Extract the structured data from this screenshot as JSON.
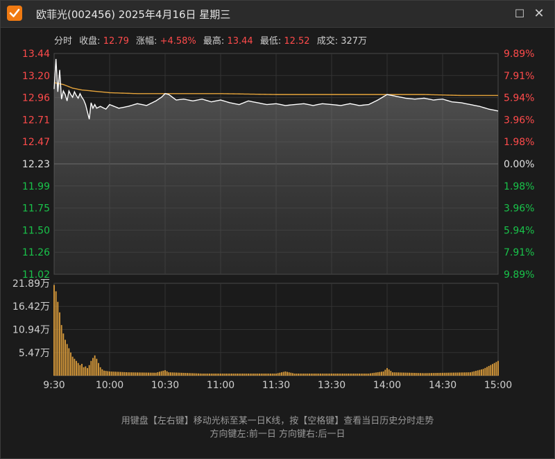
{
  "window": {
    "title": "欧菲光(002456) 2025年4月16日 星期三",
    "maximize_label": "☐",
    "close_label": "✕"
  },
  "info": {
    "mode": "分时",
    "close_label": "收盘:",
    "close_value": "12.79",
    "change_label": "涨幅:",
    "change_value": "+4.58%",
    "high_label": "最高:",
    "high_value": "13.44",
    "low_label": "最低:",
    "low_value": "12.52",
    "volume_label": "成交:",
    "volume_value": "327万"
  },
  "footer": {
    "line1": "用键盘【左右键】移动光标至某一日K线，按【空格键】查看当日历史分时走势",
    "line2": "方向键左:前一日    方向键右:后一日"
  },
  "colors": {
    "up": "#ff4b4b",
    "down": "#19c34a",
    "neutral": "#e0e0e0",
    "price_line": "#ffffff",
    "avg_line": "#e6a43b",
    "volume_bar": "#d79a3a"
  },
  "chart_data": [
    {
      "type": "line",
      "name": "intraday-price",
      "ylim": [
        11.02,
        13.44
      ],
      "prev_close": 12.23,
      "y_ticks_left": [
        "13.44",
        "13.20",
        "12.96",
        "12.71",
        "12.47",
        "12.23",
        "11.99",
        "11.75",
        "11.50",
        "11.26",
        "11.02"
      ],
      "y_ticks_right": [
        "9.89%",
        "7.91%",
        "5.94%",
        "3.96%",
        "1.98%",
        "0.00%",
        "1.98%",
        "3.96%",
        "5.94%",
        "7.91%",
        "9.89%"
      ],
      "x_ticks": [
        "9:30",
        "10:00",
        "10:30",
        "11:00",
        "11:30",
        "13:30",
        "14:00",
        "14:30",
        "15:00"
      ],
      "minutes": 241,
      "price_keypoints": [
        [
          0,
          13.05
        ],
        [
          1,
          13.38
        ],
        [
          2,
          13.02
        ],
        [
          3,
          13.26
        ],
        [
          4,
          12.94
        ],
        [
          5,
          13.03
        ],
        [
          6,
          12.99
        ],
        [
          7,
          12.92
        ],
        [
          8,
          13.03
        ],
        [
          9,
          12.99
        ],
        [
          10,
          12.96
        ],
        [
          11,
          13.02
        ],
        [
          12,
          12.98
        ],
        [
          13,
          12.95
        ],
        [
          14,
          13.0
        ],
        [
          15,
          12.96
        ],
        [
          16,
          12.93
        ],
        [
          17,
          12.88
        ],
        [
          18,
          12.8
        ],
        [
          19,
          12.72
        ],
        [
          20,
          12.9
        ],
        [
          21,
          12.84
        ],
        [
          22,
          12.88
        ],
        [
          23,
          12.84
        ],
        [
          25,
          12.86
        ],
        [
          28,
          12.83
        ],
        [
          30,
          12.88
        ],
        [
          35,
          12.84
        ],
        [
          40,
          12.86
        ],
        [
          45,
          12.89
        ],
        [
          50,
          12.87
        ],
        [
          55,
          12.92
        ],
        [
          58,
          12.96
        ],
        [
          60,
          13.0
        ],
        [
          62,
          12.99
        ],
        [
          64,
          12.96
        ],
        [
          66,
          12.93
        ],
        [
          70,
          12.94
        ],
        [
          75,
          12.92
        ],
        [
          80,
          12.94
        ],
        [
          85,
          12.91
        ],
        [
          90,
          12.93
        ],
        [
          95,
          12.9
        ],
        [
          100,
          12.88
        ],
        [
          105,
          12.92
        ],
        [
          110,
          12.9
        ],
        [
          115,
          12.88
        ],
        [
          120,
          12.89
        ],
        [
          125,
          12.87
        ],
        [
          130,
          12.88
        ],
        [
          135,
          12.89
        ],
        [
          140,
          12.87
        ],
        [
          145,
          12.89
        ],
        [
          150,
          12.88
        ],
        [
          155,
          12.87
        ],
        [
          160,
          12.89
        ],
        [
          165,
          12.87
        ],
        [
          170,
          12.88
        ],
        [
          175,
          12.93
        ],
        [
          180,
          12.99
        ],
        [
          185,
          12.97
        ],
        [
          190,
          12.95
        ],
        [
          195,
          12.94
        ],
        [
          200,
          12.95
        ],
        [
          205,
          12.93
        ],
        [
          210,
          12.94
        ],
        [
          215,
          12.91
        ],
        [
          220,
          12.9
        ],
        [
          225,
          12.88
        ],
        [
          230,
          12.86
        ],
        [
          235,
          12.83
        ],
        [
          240,
          12.81
        ]
      ],
      "avg_keypoints": [
        [
          0,
          13.12
        ],
        [
          5,
          13.1
        ],
        [
          10,
          13.06
        ],
        [
          15,
          13.04
        ],
        [
          20,
          13.03
        ],
        [
          30,
          13.01
        ],
        [
          45,
          13.0
        ],
        [
          60,
          13.0
        ],
        [
          90,
          13.0
        ],
        [
          120,
          12.99
        ],
        [
          150,
          12.99
        ],
        [
          180,
          12.99
        ],
        [
          200,
          12.99
        ],
        [
          220,
          12.98
        ],
        [
          240,
          12.98
        ]
      ]
    },
    {
      "type": "bar",
      "name": "volume",
      "unit": "万",
      "ylim": [
        0,
        21.89
      ],
      "y_ticks": [
        "21.89万",
        "16.42万",
        "10.94万",
        "5.47万"
      ],
      "bar_keypoints": [
        [
          0,
          21.5
        ],
        [
          1,
          20.0
        ],
        [
          2,
          17.5
        ],
        [
          3,
          15.0
        ],
        [
          4,
          12.0
        ],
        [
          5,
          10.0
        ],
        [
          6,
          8.5
        ],
        [
          7,
          7.5
        ],
        [
          8,
          6.5
        ],
        [
          9,
          5.5
        ],
        [
          10,
          4.5
        ],
        [
          11,
          4.0
        ],
        [
          12,
          3.5
        ],
        [
          13,
          3.0
        ],
        [
          14,
          2.5
        ],
        [
          15,
          2.8
        ],
        [
          16,
          2.0
        ],
        [
          17,
          2.2
        ],
        [
          18,
          1.8
        ],
        [
          19,
          2.5
        ],
        [
          20,
          3.5
        ],
        [
          21,
          4.2
        ],
        [
          22,
          4.8
        ],
        [
          23,
          4.0
        ],
        [
          24,
          3.0
        ],
        [
          25,
          2.0
        ],
        [
          26,
          1.5
        ],
        [
          27,
          1.2
        ],
        [
          30,
          1.0
        ],
        [
          40,
          0.8
        ],
        [
          55,
          0.7
        ],
        [
          60,
          1.3
        ],
        [
          62,
          0.8
        ],
        [
          80,
          0.5
        ],
        [
          100,
          0.5
        ],
        [
          120,
          0.5
        ],
        [
          125,
          1.0
        ],
        [
          130,
          0.5
        ],
        [
          150,
          0.5
        ],
        [
          170,
          0.5
        ],
        [
          178,
          1.0
        ],
        [
          180,
          1.8
        ],
        [
          183,
          0.8
        ],
        [
          200,
          0.6
        ],
        [
          225,
          0.8
        ],
        [
          232,
          1.6
        ],
        [
          235,
          2.3
        ],
        [
          238,
          3.0
        ],
        [
          240,
          3.5
        ]
      ]
    }
  ]
}
